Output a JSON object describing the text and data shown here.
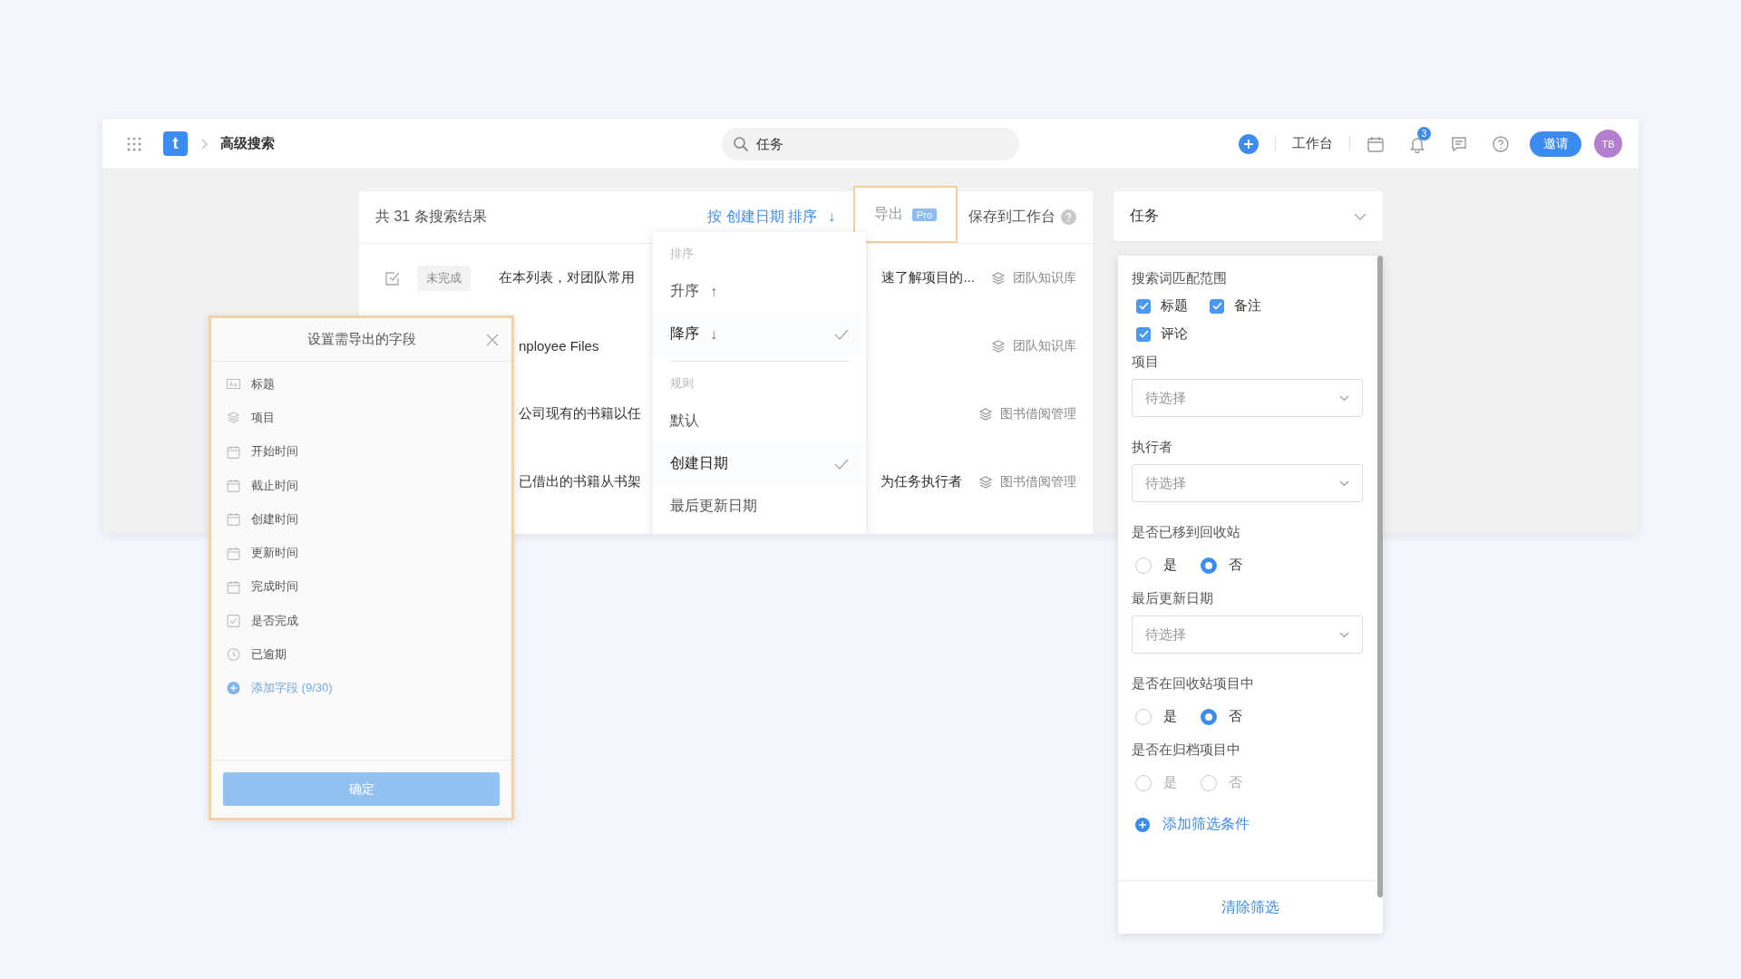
{
  "topbar": {
    "logo": "t",
    "breadcrumb": "高级搜索",
    "search": {
      "value": "任务"
    },
    "workspace": "工作台",
    "notifications": "3",
    "invite": "邀请",
    "avatar": "TB"
  },
  "results": {
    "count": "共 31 条搜索结果",
    "sort": {
      "label": "按 创建日期 排序",
      "arrow": "↓"
    },
    "export": {
      "label": "导出",
      "badge": "Pro",
      "highlighted": true
    },
    "save": "保存到工作台",
    "rows": [
      {
        "status": "未完成",
        "title_start": "在本列表，对团队常用",
        "title_end": "速了解项目的...",
        "project": "团队知识库"
      },
      {
        "title_start": "nployee Files",
        "project": "团队知识库"
      },
      {
        "title_start": "公司现有的书籍以任",
        "project": "图书借阅管理"
      },
      {
        "title_start": "已借出的书籍从书架",
        "title_end": "为任务执行者",
        "project": "图书借阅管理"
      }
    ]
  },
  "sort_menu": {
    "sections": [
      {
        "heading": "排序",
        "items": [
          {
            "label": "升序",
            "arrow": "↑",
            "selected": false
          },
          {
            "label": "降序",
            "arrow": "↓",
            "selected": true
          }
        ]
      },
      {
        "heading": "规则",
        "items": [
          {
            "label": "默认",
            "selected": false
          },
          {
            "label": "创建日期",
            "selected": true
          },
          {
            "label": "最后更新日期",
            "selected": false
          }
        ]
      }
    ]
  },
  "export_dialog": {
    "title": "设置需导出的字段",
    "highlighted": true,
    "fields": [
      {
        "kind": "text",
        "label": "标题"
      },
      {
        "kind": "project",
        "label": "项目"
      },
      {
        "kind": "date",
        "label": "开始时间"
      },
      {
        "kind": "date",
        "label": "截止时间"
      },
      {
        "kind": "date",
        "label": "创建时间"
      },
      {
        "kind": "date",
        "label": "更新时间"
      },
      {
        "kind": "date",
        "label": "完成时间"
      },
      {
        "kind": "check",
        "label": "是否完成"
      },
      {
        "kind": "clock",
        "label": "已逾期"
      }
    ],
    "add_field": "添加字段 (9/30)",
    "confirm": "确定"
  },
  "filter": {
    "scope": "任务",
    "sections": [
      {
        "kind": "checkboxes",
        "label": "搜索词匹配范围",
        "options": [
          {
            "label": "标题",
            "checked": true
          },
          {
            "label": "备注",
            "checked": true
          },
          {
            "label": "评论",
            "checked": true
          }
        ]
      },
      {
        "kind": "select",
        "label": "项目",
        "placeholder": "待选择"
      },
      {
        "kind": "select",
        "label": "执行者",
        "placeholder": "待选择"
      },
      {
        "kind": "radios",
        "label": "是否已移到回收站",
        "disabled": false,
        "options": [
          {
            "label": "是",
            "selected": false
          },
          {
            "label": "否",
            "selected": true
          }
        ]
      },
      {
        "kind": "select",
        "label": "最后更新日期",
        "placeholder": "待选择"
      },
      {
        "kind": "radios",
        "label": "是否在回收站项目中",
        "disabled": false,
        "options": [
          {
            "label": "是",
            "selected": false
          },
          {
            "label": "否",
            "selected": true
          }
        ]
      },
      {
        "kind": "radios",
        "label": "是否在归档项目中",
        "disabled": true,
        "options": [
          {
            "label": "是",
            "selected": false
          },
          {
            "label": "否",
            "selected": false
          }
        ]
      }
    ],
    "add_filter": "添加筛选条件",
    "clear": "清除筛选"
  }
}
